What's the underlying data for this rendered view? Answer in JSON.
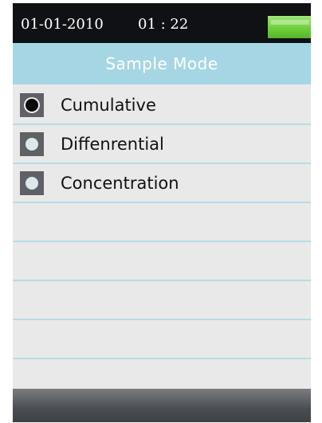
{
  "status_bar": {
    "date": "01-01-2010",
    "time": "01 : 22",
    "battery_icon": "battery-full-icon",
    "battery_color": "#6fcf3b"
  },
  "title_bar": {
    "title": "Sample Mode",
    "background": "#a6d6e3"
  },
  "options": [
    {
      "label": "Cumulative",
      "selected": true
    },
    {
      "label": "Diffenrential",
      "selected": false
    },
    {
      "label": "Concentration",
      "selected": false
    }
  ],
  "empty_rows": 5
}
